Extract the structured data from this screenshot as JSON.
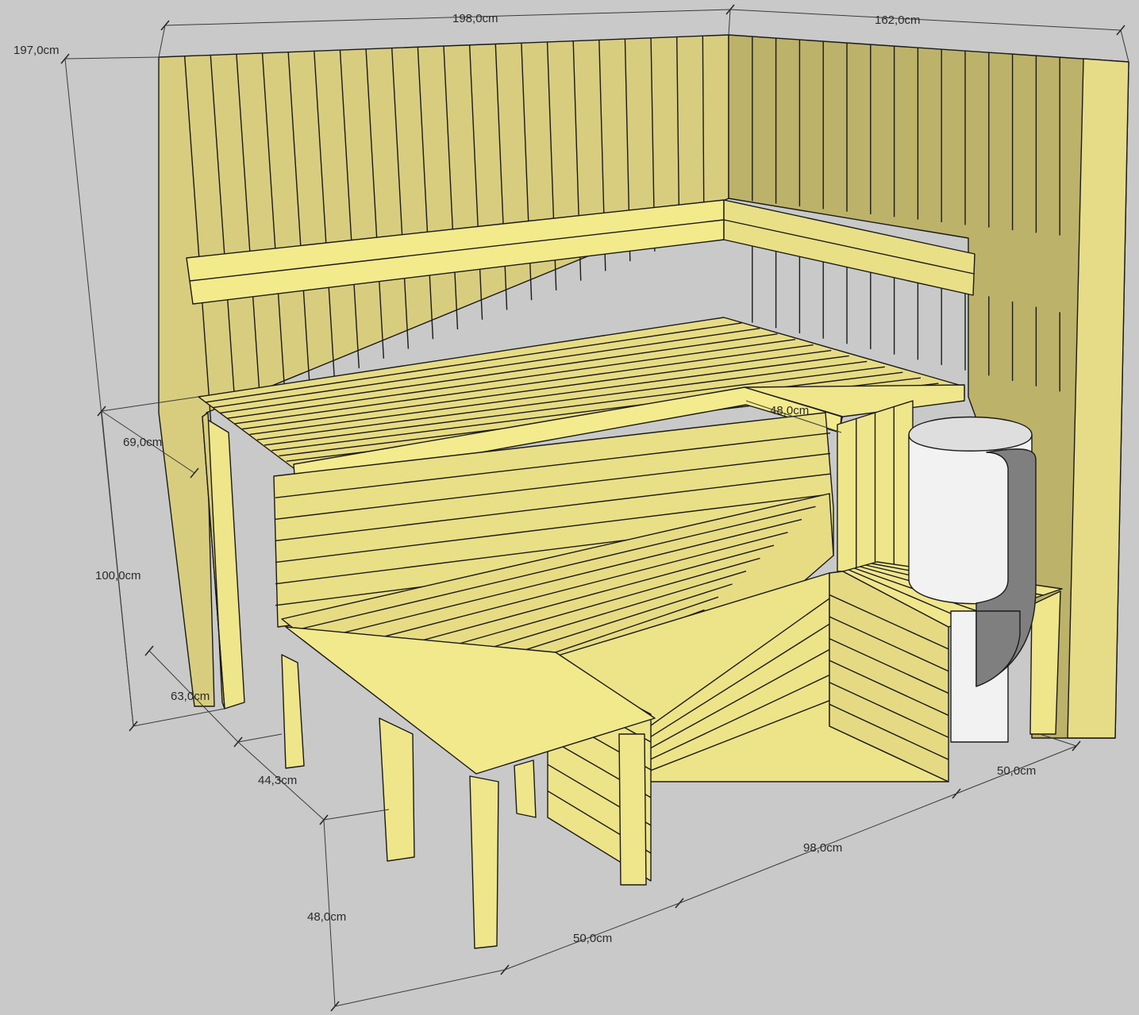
{
  "colors": {
    "background": "#c9c9c9",
    "wood_light": "#f0e68c",
    "wood_mid": "#ddd27a",
    "wood_dark": "#b9ae62",
    "wall_back": "#d8cd7f",
    "wall_side": "#bcb26a",
    "heater_light": "#f2f2f2",
    "heater_shade": "#c4c4c4",
    "heater_panel": "#7f7f7f",
    "outline": "#1a1a1a"
  },
  "dimensions": {
    "back_wall_width": "198,0cm",
    "side_wall_width": "162,0cm",
    "wall_height": "197,0cm",
    "upper_bench_depth": "69,0cm",
    "upper_bench_extension": "48,0cm",
    "upper_bench_height": "100,0cm",
    "lower_bench_depth": "63,0cm",
    "lower_bench_offset": "44,3cm",
    "step_height": "48,0cm",
    "step_width": "50,0cm",
    "lower_bench_length": "98,0cm",
    "heater_zone_width": "50,0cm"
  }
}
